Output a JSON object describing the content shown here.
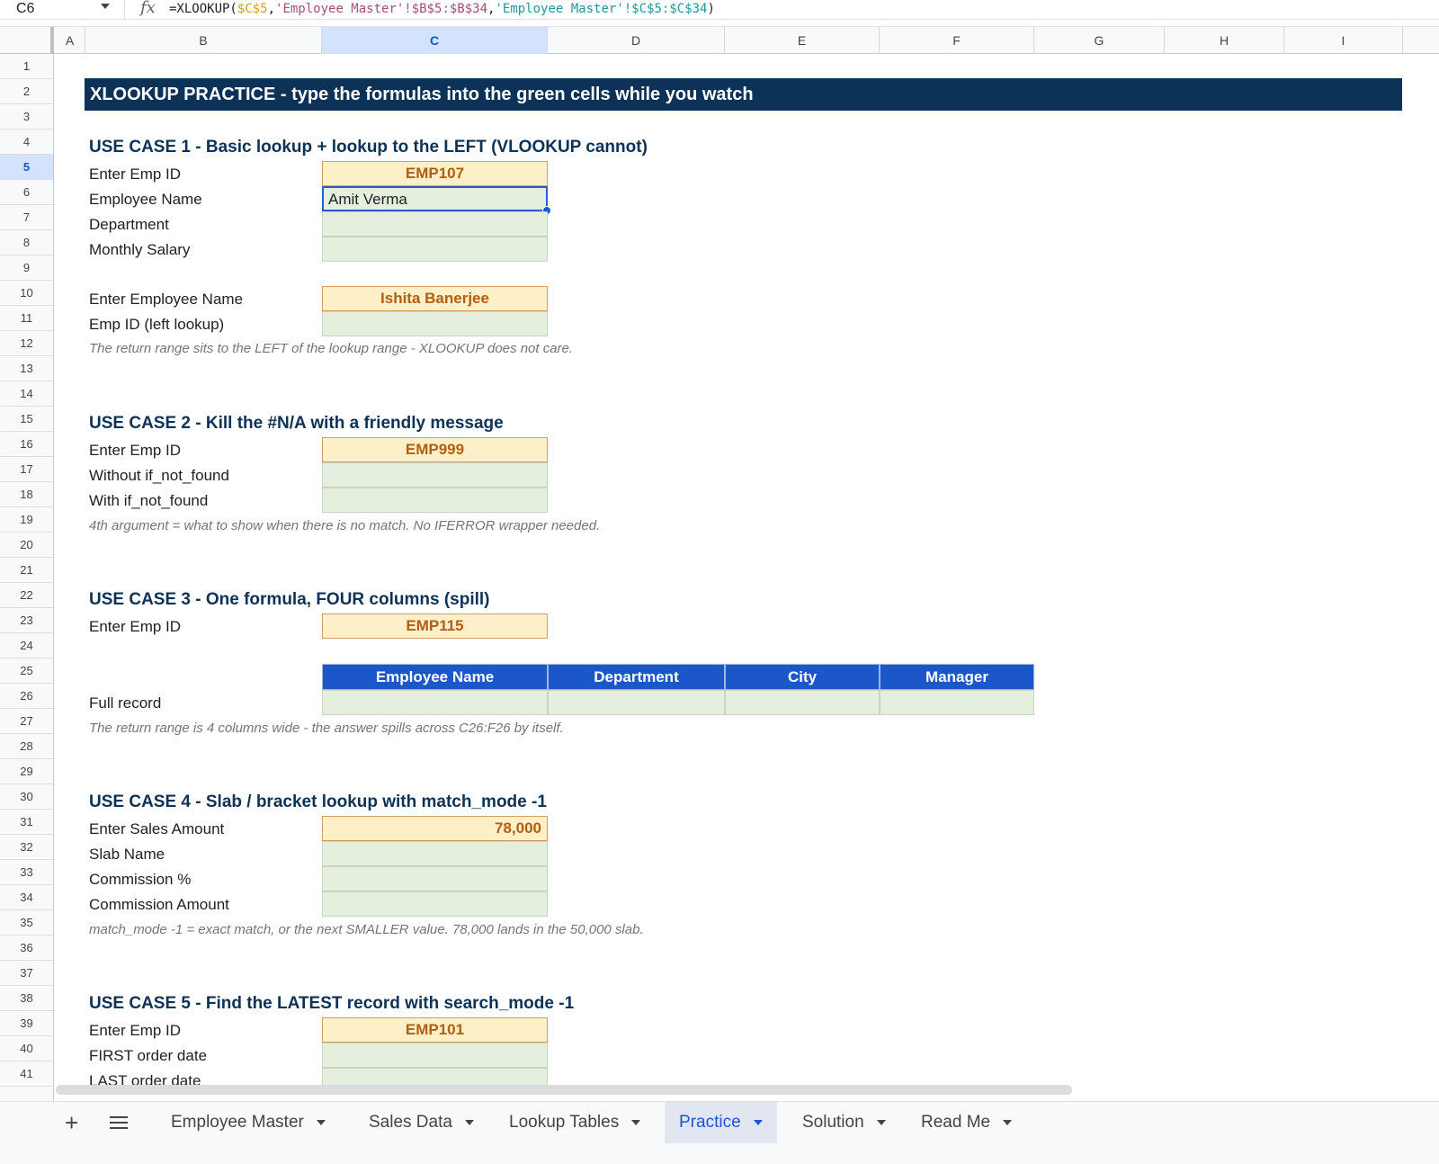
{
  "formula_bar": {
    "name_box": "C6",
    "fx_label": "fx",
    "formula_prefix": "=XLOOKUP(",
    "ref1": "$C$5",
    "comma1": ",",
    "ref2": "'Employee Master'!$B$5:$B$34",
    "comma2": ",",
    "ref3": "'Employee Master'!$C$5:$C$34",
    "formula_suffix": ")"
  },
  "columns": [
    "A",
    "B",
    "C",
    "D",
    "E",
    "F",
    "G",
    "H",
    "I"
  ],
  "selected_column": "C",
  "rows": [
    "1",
    "2",
    "3",
    "4",
    "5",
    "6",
    "7",
    "8",
    "9",
    "10",
    "11",
    "12",
    "13",
    "14",
    "15",
    "16",
    "17",
    "18",
    "19",
    "20",
    "21",
    "22",
    "23",
    "24",
    "25",
    "26",
    "27",
    "28",
    "29",
    "30",
    "31",
    "32",
    "33",
    "34",
    "35",
    "36",
    "37",
    "38",
    "39",
    "40",
    "41"
  ],
  "selected_row": "5",
  "sheet": {
    "title": "XLOOKUP PRACTICE  -  type the formulas into the green cells while you watch",
    "uc1": {
      "heading": "USE CASE 1  -  Basic lookup + lookup to the LEFT (VLOOKUP cannot)",
      "label_empid": "Enter Emp ID",
      "empid": "EMP107",
      "label_name": "Employee Name",
      "name_value": "Amit Verma",
      "label_dept": "Department",
      "label_salary": "Monthly Salary",
      "label_enter_name": "Enter Employee Name",
      "enter_name": "Ishita Banerjee",
      "label_left": "Emp ID  (left lookup)",
      "note": "The return range sits to the LEFT of the lookup range - XLOOKUP does not care."
    },
    "uc2": {
      "heading": "USE CASE 2  -  Kill the #N/A with a friendly message",
      "label_empid": "Enter Emp ID",
      "empid": "EMP999",
      "label_without": "Without if_not_found",
      "label_with": "With if_not_found",
      "note": "4th argument = what to show when there is no match. No IFERROR wrapper needed."
    },
    "uc3": {
      "heading": "USE CASE 3  -  One formula, FOUR columns (spill)",
      "label_empid": "Enter Emp ID",
      "empid": "EMP115",
      "headers": [
        "Employee Name",
        "Department",
        "City",
        "Manager"
      ],
      "label_full": "Full record",
      "note": "The return range is 4 columns wide - the answer spills across C26:F26 by itself."
    },
    "uc4": {
      "heading": "USE CASE 4  -  Slab / bracket lookup with match_mode -1",
      "label_sales": "Enter Sales Amount",
      "sales": "78,000",
      "label_slab": "Slab Name",
      "label_pct": "Commission %",
      "label_amt": "Commission Amount",
      "note": "match_mode -1 = exact match, or the next SMALLER value. 78,000 lands in the 50,000 slab."
    },
    "uc5": {
      "heading": "USE CASE 5  -  Find the LATEST record with search_mode -1",
      "label_empid": "Enter Emp ID",
      "empid": "EMP101",
      "label_first": "FIRST order date",
      "label_last": "LAST order date"
    }
  },
  "tabs": {
    "add_label": "+",
    "items": [
      "Employee Master",
      "Sales Data",
      "Lookup Tables",
      "Practice",
      "Solution",
      "Read Me"
    ],
    "active": "Practice"
  },
  "colors": {
    "title_bg": "#0d3257",
    "input_fill": "#fdf0c9",
    "output_fill": "#e5efdd",
    "table_header": "#1b57c8",
    "selection": "#0b57d0"
  }
}
